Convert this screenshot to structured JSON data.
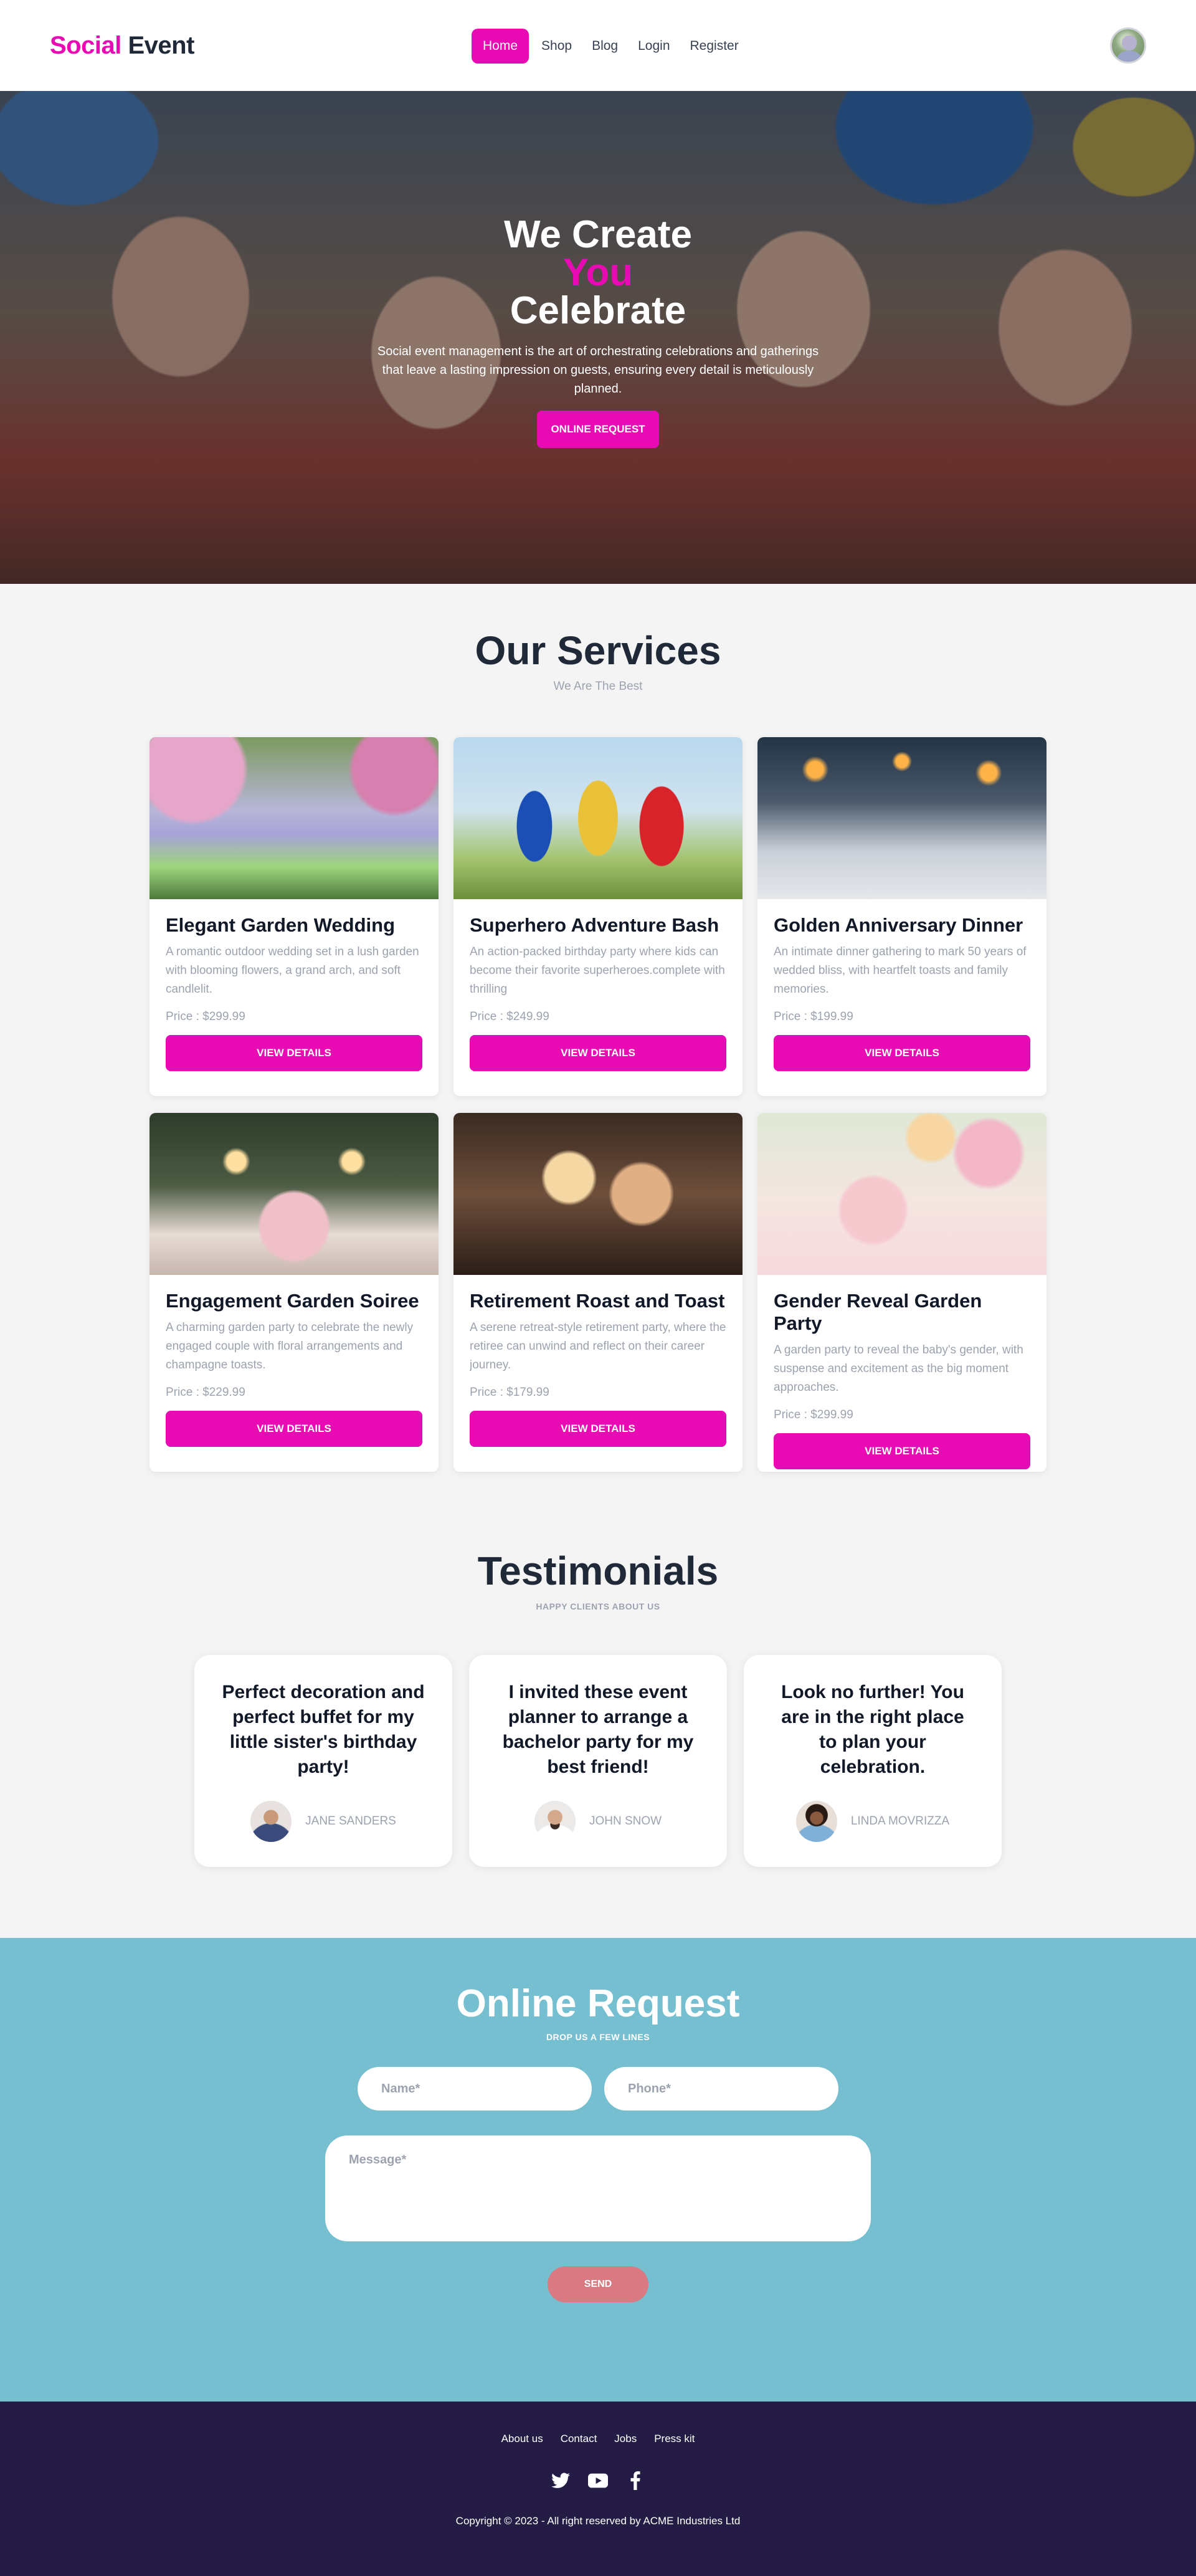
{
  "brand": {
    "part1": "Social",
    "part2": "Event"
  },
  "nav": {
    "items": [
      {
        "label": "Home"
      },
      {
        "label": "Shop"
      },
      {
        "label": "Blog"
      },
      {
        "label": "Login"
      },
      {
        "label": "Register"
      }
    ]
  },
  "hero": {
    "line1": "We Create",
    "line2": "You",
    "line3": "Celebrate",
    "text": "Social event management is the art of orchestrating celebrations and gatherings that leave a lasting impression on guests, ensuring every detail is meticulously planned.",
    "button": "ONLINE REQUEST"
  },
  "services": {
    "title": "Our Services",
    "subtitle": "We Are The Best",
    "cards": [
      {
        "title": "Elegant Garden Wedding",
        "desc": "A romantic outdoor wedding set in a lush garden with blooming flowers, a grand arch, and soft candlelit.",
        "price": "Price : $299.99",
        "button": "VIEW DETAILS"
      },
      {
        "title": "Superhero Adventure Bash",
        "desc": "An action-packed birthday party where kids can become their favorite superheroes.complete with thrilling",
        "price": "Price : $249.99",
        "button": "VIEW DETAILS"
      },
      {
        "title": "Golden Anniversary Dinner",
        "desc": "An intimate dinner gathering to mark 50 years of wedded bliss, with heartfelt toasts and family memories.",
        "price": "Price : $199.99",
        "button": "VIEW DETAILS"
      },
      {
        "title": "Engagement Garden Soiree",
        "desc": "A charming garden party to celebrate the newly engaged couple with floral arrangements and champagne toasts.",
        "price": "Price : $229.99",
        "button": "VIEW DETAILS"
      },
      {
        "title": "Retirement Roast and Toast",
        "desc": "A serene retreat-style retirement party, where the retiree can unwind and reflect on their career journey.",
        "price": "Price : $179.99",
        "button": "VIEW DETAILS"
      },
      {
        "title": "Gender Reveal Garden Party",
        "desc": "A garden party to reveal the baby's gender, with suspense and excitement as the big moment approaches.",
        "price": "Price : $299.99",
        "button": "VIEW DETAILS"
      }
    ]
  },
  "testimonials": {
    "title": "Testimonials",
    "subtitle": "HAPPY CLIENTS ABOUT US",
    "items": [
      {
        "quote": "Perfect decoration and perfect buffet for my little sister's birthday party!",
        "name": "Jane Sanders"
      },
      {
        "quote": "I invited these event planner to arrange a bachelor party for my best friend!",
        "name": "John Snow"
      },
      {
        "quote": "Look no further! You are in the right place to plan your celebration.",
        "name": "Linda Movrizza"
      }
    ]
  },
  "request": {
    "title": "Online Request",
    "subtitle": "DROP US A FEW LINES",
    "name_placeholder": "Name*",
    "phone_placeholder": "Phone*",
    "message_placeholder": "Message*",
    "button": "SEND"
  },
  "footer": {
    "links": [
      {
        "label": "About us"
      },
      {
        "label": "Contact"
      },
      {
        "label": "Jobs"
      },
      {
        "label": "Press kit"
      }
    ],
    "social_icons": [
      "twitter-icon",
      "youtube-icon",
      "facebook-icon"
    ],
    "copyright": "Copyright © 2023 - All right reserved by ACME Industries Ltd"
  },
  "colors": {
    "accent": "#e80ab3",
    "request_bg": "#76bfd0",
    "footer_bg": "#251c46",
    "send_button": "#d97a82"
  }
}
